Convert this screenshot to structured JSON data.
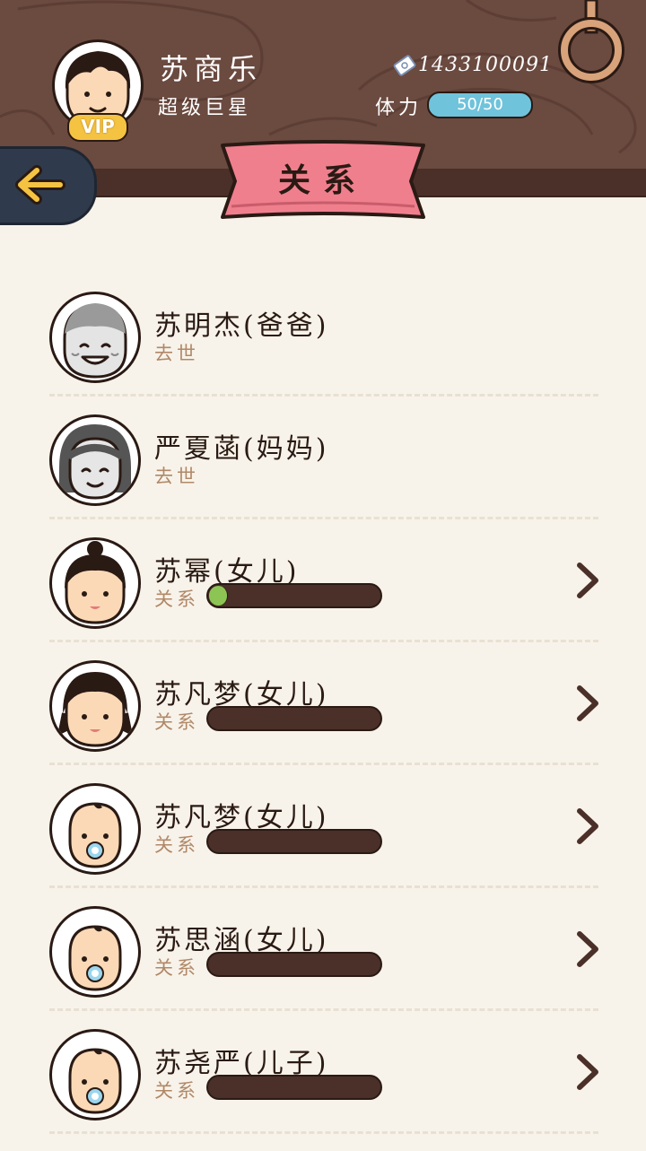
{
  "header": {
    "player_name": "苏商乐",
    "player_title": "超级巨星",
    "vip_label": "VIP",
    "money": "1433100091",
    "stamina_label": "体力",
    "stamina_value": "50/50"
  },
  "page_title": "关系",
  "relationship_label": "关系",
  "members": [
    {
      "name": "苏明杰(爸爸)",
      "status": "去世",
      "deceased": true,
      "age": "elder-man",
      "relationship_level": null
    },
    {
      "name": "严夏菡(妈妈)",
      "status": "去世",
      "deceased": true,
      "age": "elder-woman",
      "relationship_level": null
    },
    {
      "name": "苏幂(女儿)",
      "status": "",
      "deceased": false,
      "age": "girl-bun",
      "relationship_level": 0.08
    },
    {
      "name": "苏凡梦(女儿)",
      "status": "",
      "deceased": false,
      "age": "girl-braids",
      "relationship_level": 0
    },
    {
      "name": "苏凡梦(女儿)",
      "status": "",
      "deceased": false,
      "age": "baby",
      "relationship_level": 0
    },
    {
      "name": "苏思涵(女儿)",
      "status": "",
      "deceased": false,
      "age": "baby",
      "relationship_level": 0
    },
    {
      "name": "苏尧严(儿子)",
      "status": "",
      "deceased": false,
      "age": "baby",
      "relationship_level": 0
    }
  ],
  "colors": {
    "header_wood": "#6b4a40",
    "ribbon": "#f07f8d",
    "stamina": "#6fc3db",
    "relationship_fill": "#8cc554",
    "background": "#f8f3ea"
  }
}
